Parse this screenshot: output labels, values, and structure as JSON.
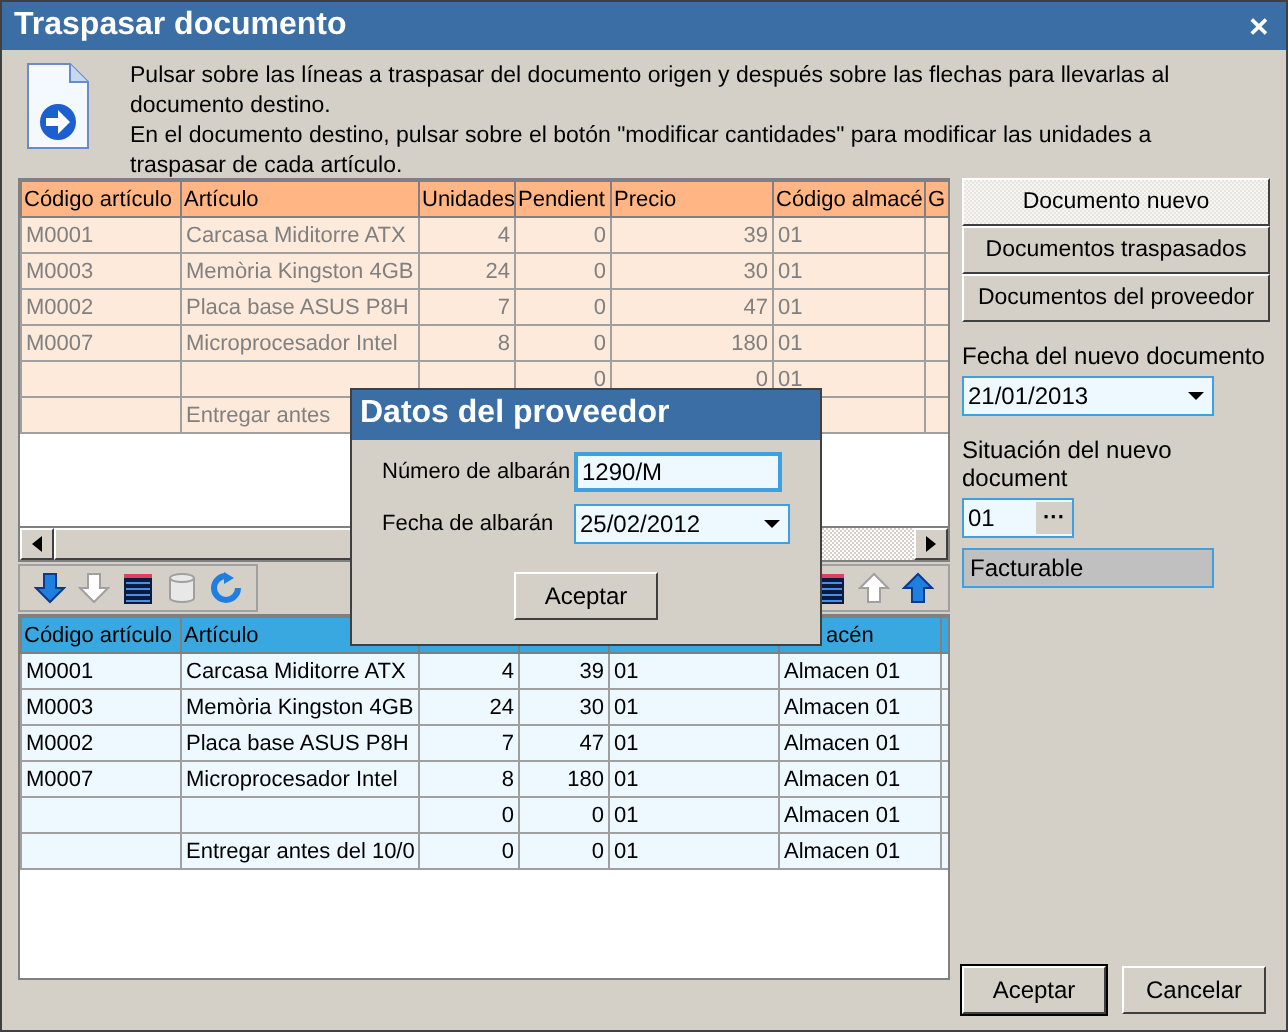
{
  "window": {
    "title": "Traspasar documento",
    "close": "✕"
  },
  "instructions": [
    "Pulsar sobre las líneas a traspasar del documento origen y después sobre las flechas para llevarlas al documento destino.",
    "En el documento destino, pulsar sobre el botón \"modificar cantidades\" para modificar las unidades a traspasar de cada artículo."
  ],
  "source_grid": {
    "columns": [
      "Código artículo",
      "Artículo",
      "Unidades",
      "Pendient",
      "Precio",
      "Código almacé",
      "G"
    ],
    "rows": [
      [
        "M0001",
        "Carcasa Miditorre ATX",
        "4",
        "0",
        "39",
        "01",
        null
      ],
      [
        "M0003",
        "Memòria Kingston 4GB",
        "24",
        "0",
        "30",
        "01",
        null
      ],
      [
        "M0002",
        "Placa base ASUS P8H",
        "7",
        "0",
        "47",
        "01",
        null
      ],
      [
        "M0007",
        "Microprocesador Intel",
        "8",
        "0",
        "180",
        "01",
        null
      ],
      [
        null,
        null,
        null,
        "0",
        "0",
        "01",
        null
      ],
      [
        null,
        "Entregar antes",
        null,
        null,
        null,
        null,
        null
      ]
    ]
  },
  "left_tools": [
    {
      "kind": "down",
      "disabled": false
    },
    {
      "kind": "down",
      "disabled": true
    },
    {
      "kind": "table",
      "disabled": false
    },
    {
      "kind": "cylinder",
      "disabled": true
    },
    {
      "kind": "refresh",
      "disabled": false
    }
  ],
  "right_tools": [
    {
      "kind": "table",
      "disabled": false
    },
    {
      "kind": "up",
      "disabled": true
    },
    {
      "kind": "up",
      "disabled": false
    }
  ],
  "target_grid": {
    "columns": [
      "Código artículo",
      "Artículo",
      null,
      null,
      null,
      "acén",
      null
    ],
    "rows": [
      [
        "M0001",
        "Carcasa Miditorre ATX",
        "4",
        "39",
        "01",
        "Almacen 01",
        null
      ],
      [
        "M0003",
        "Memòria Kingston 4GB",
        "24",
        "30",
        "01",
        "Almacen 01",
        null
      ],
      [
        "M0002",
        "Placa base ASUS P8H",
        "7",
        "47",
        "01",
        "Almacen 01",
        null
      ],
      [
        "M0007",
        "Microprocesador Intel",
        "8",
        "180",
        "01",
        "Almacen 01",
        null
      ],
      [
        null,
        null,
        "0",
        "0",
        "01",
        "Almacen 01",
        null
      ],
      [
        null,
        "Entregar antes del 10/0",
        "0",
        "0",
        "01",
        "Almacen 01",
        null
      ]
    ]
  },
  "sidebar": {
    "tabs": [
      {
        "label": "Documento nuevo",
        "selected": true
      },
      {
        "label": "Documentos traspasados",
        "selected": false
      },
      {
        "label": "Documentos del proveedor",
        "selected": false
      }
    ],
    "date_label": "Fecha del nuevo documento",
    "date_value": "21/01/2013",
    "status_label": "Situación del nuevo document",
    "status_code": "01",
    "status_button": "···",
    "status_name": "Facturable"
  },
  "buttons": [
    "Aceptar",
    "Cancelar"
  ],
  "dialog": {
    "title": "Datos del proveedor",
    "fields": [
      {
        "kind": "text",
        "label": "Número de albarán",
        "value": "1290/M"
      },
      {
        "kind": "date",
        "label": "Fecha de albarán",
        "value": "25/02/2012"
      }
    ],
    "button": "Aceptar"
  }
}
